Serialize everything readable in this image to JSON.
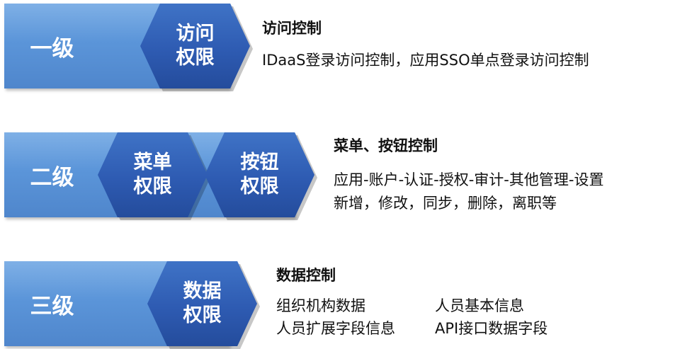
{
  "rows": [
    {
      "level": "一级",
      "hexes": [
        "访问权限"
      ],
      "title": "访问控制",
      "lines": [
        "IDaaS登录访问控制，应用SSO单点登录访问控制"
      ]
    },
    {
      "level": "二级",
      "hexes": [
        "菜单权限",
        "按钮权限"
      ],
      "title": "菜单、按钮控制",
      "lines": [
        "应用-账户-认证-授权-审计-其他管理-设置",
        "新增，修改，同步，删除，离职等"
      ]
    },
    {
      "level": "三级",
      "hexes": [
        "数据权限"
      ],
      "title": "数据控制",
      "items": [
        "组织机构数据",
        "人员基本信息",
        "人员扩展字段信息",
        "API接口数据字段"
      ]
    }
  ],
  "colors": {
    "bar": "#5b95d9",
    "hex": "#2e5bb2",
    "text": "#111111"
  }
}
